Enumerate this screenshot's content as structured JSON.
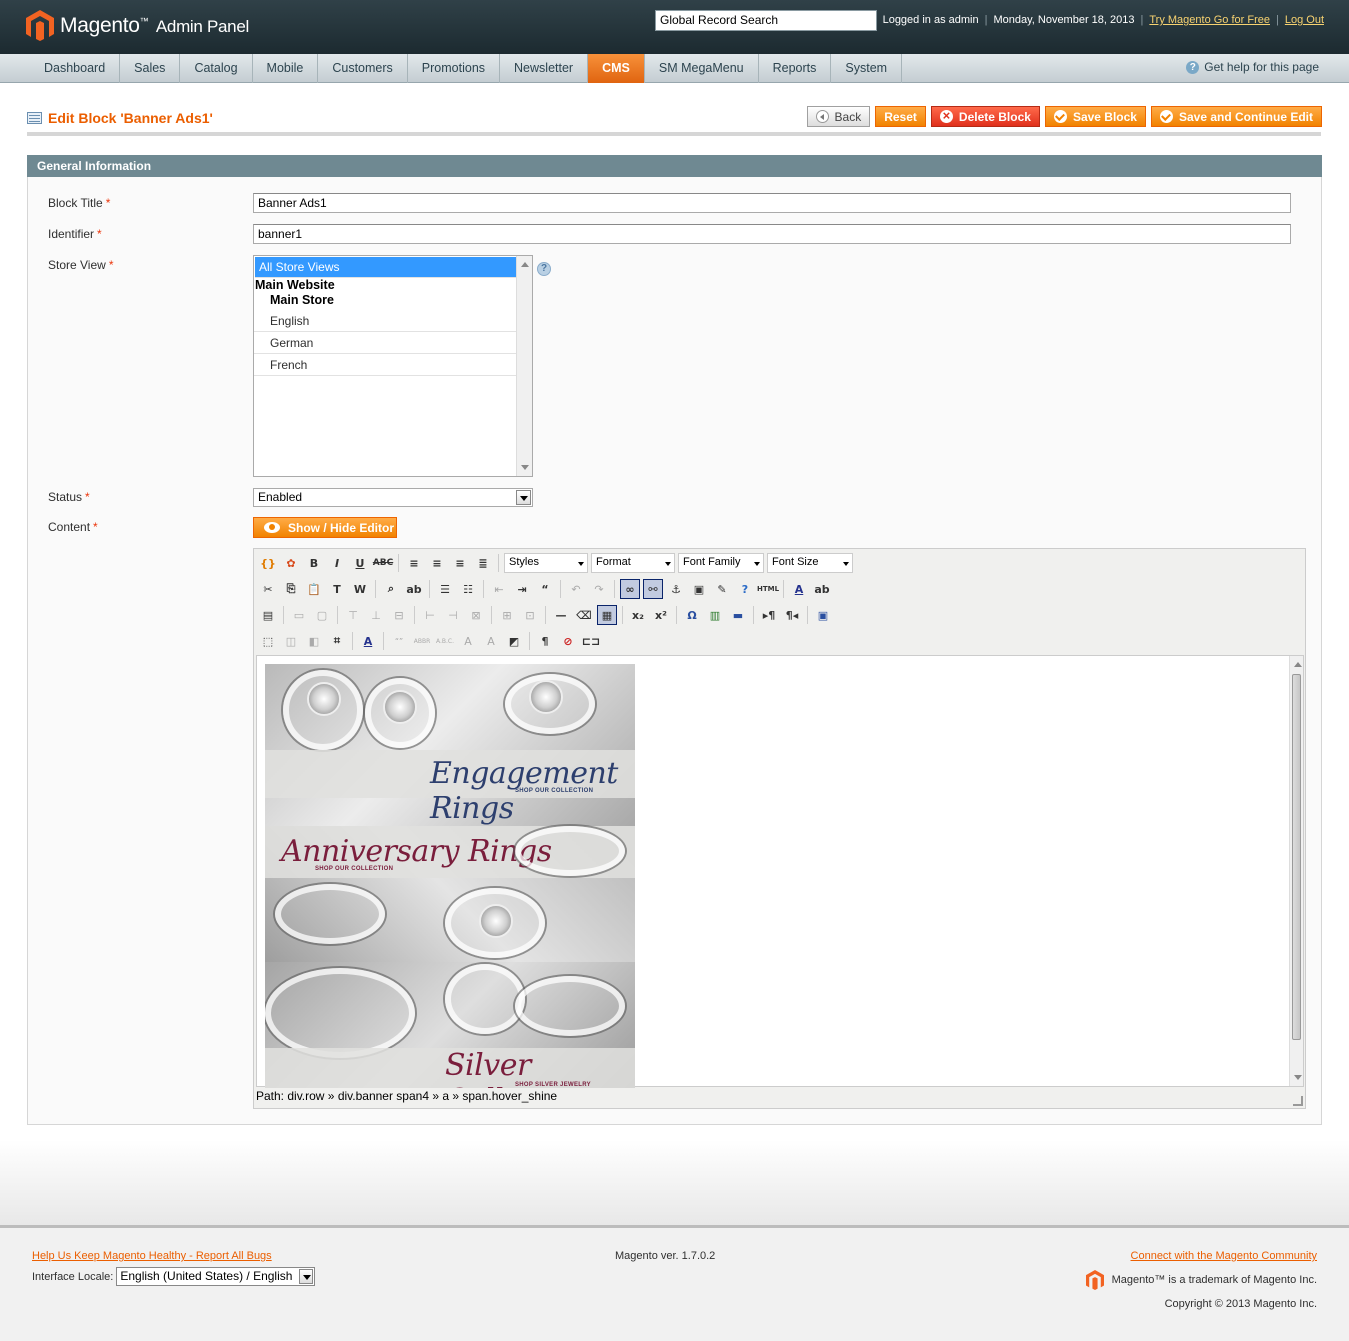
{
  "header": {
    "brand": "Magento",
    "brand_sub": "Admin Panel",
    "search_placeholder": "Global Record Search",
    "logged_in": "Logged in as admin",
    "date": "Monday, November 18, 2013",
    "try_link": "Try Magento Go for Free",
    "logout": "Log Out"
  },
  "nav": {
    "items": [
      "Dashboard",
      "Sales",
      "Catalog",
      "Mobile",
      "Customers",
      "Promotions",
      "Newsletter",
      "CMS",
      "SM MegaMenu",
      "Reports",
      "System"
    ],
    "active": "CMS",
    "help": "Get help for this page"
  },
  "page": {
    "title": "Edit Block 'Banner Ads1'",
    "buttons": {
      "back": "Back",
      "reset": "Reset",
      "delete": "Delete Block",
      "save": "Save Block",
      "save_continue": "Save and Continue Edit"
    }
  },
  "section": {
    "title": "General Information"
  },
  "form": {
    "block_title_label": "Block Title",
    "block_title_value": "Banner Ads1",
    "identifier_label": "Identifier",
    "identifier_value": "banner1",
    "store_view_label": "Store View",
    "store_options": {
      "all": "All Store Views",
      "website": "Main Website",
      "store": "Main Store",
      "views": [
        "English",
        "German",
        "French"
      ]
    },
    "status_label": "Status",
    "status_value": "Enabled",
    "content_label": "Content",
    "show_hide": "Show / Hide Editor",
    "required_mark": "*"
  },
  "editor": {
    "styles": "Styles",
    "format": "Format",
    "font_family": "Font Family",
    "font_size": "Font Size",
    "path": "Path: div.row » div.banner span4 » a » span.hover_shine",
    "banners": [
      {
        "title": "Engagement Rings",
        "sub": "SHOP OUR COLLECTION"
      },
      {
        "title": "Anniversary Rings",
        "sub": "SHOP OUR COLLECTION"
      },
      {
        "title": "Silver Collection",
        "sub": "SHOP SILVER JEWELRY"
      }
    ]
  },
  "footer": {
    "report": "Help Us Keep Magento Healthy - Report All Bugs",
    "locale_label": "Interface Locale:",
    "locale_value": "English (United States) / English",
    "version": "Magento ver. 1.7.0.2",
    "community": "Connect with the Magento Community",
    "trademark": "Magento™ is a trademark of Magento Inc.",
    "copyright": "Copyright © 2013 Magento Inc."
  },
  "colors": {
    "accent": "#eb5e00",
    "header": "#2b3b42",
    "section": "#6f8992"
  }
}
